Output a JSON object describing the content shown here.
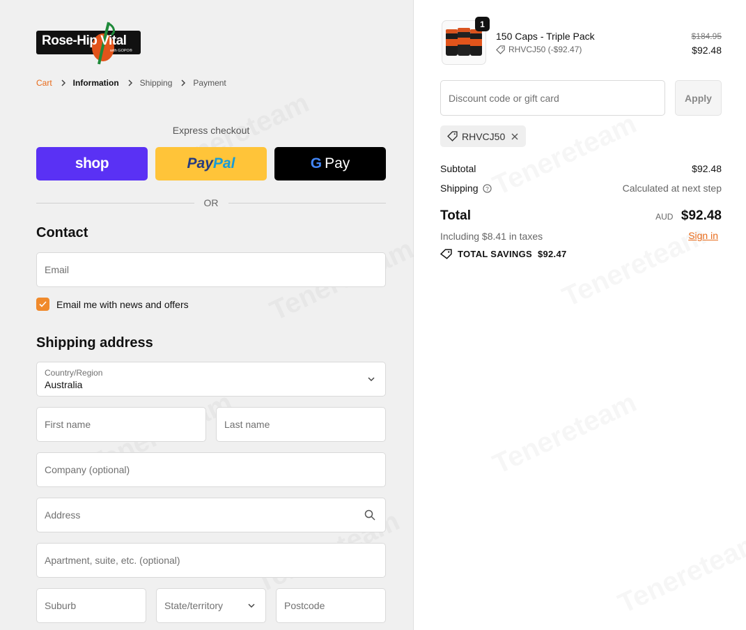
{
  "brand": {
    "logo_text": "Rose-Hip Vital",
    "logo_sub": "with GOPO®"
  },
  "breadcrumb": [
    {
      "label": "Cart",
      "state": "link"
    },
    {
      "label": "Information",
      "state": "active"
    },
    {
      "label": "Shipping",
      "state": "inactive"
    },
    {
      "label": "Payment",
      "state": "inactive"
    }
  ],
  "express": {
    "label": "Express checkout",
    "shop_label": "shop",
    "paypal_part1": "Pay",
    "paypal_part2": "Pal",
    "gpay_g": "G",
    "gpay_label": "Pay",
    "or_label": "OR"
  },
  "contact": {
    "title": "Contact",
    "signin_label": "Sign in",
    "email_placeholder": "Email",
    "newsletter_label": "Email me with news and offers",
    "newsletter_checked": true
  },
  "shipping": {
    "title": "Shipping address",
    "country_label": "Country/Region",
    "country_value": "Australia",
    "first_name": "First name",
    "last_name": "Last name",
    "company": "Company (optional)",
    "address": "Address",
    "apartment": "Apartment, suite, etc. (optional)",
    "suburb": "Suburb",
    "state": "State/territory",
    "postcode": "Postcode"
  },
  "order": {
    "item": {
      "quantity": "1",
      "name": "150 Caps - Triple Pack",
      "discount_code_line": "RHVCJ50 (-$92.47)",
      "original_price": "$184.95",
      "price": "$92.48"
    },
    "discount_placeholder": "Discount code or gift card",
    "apply_label": "Apply",
    "applied_code": "RHVCJ50",
    "subtotal_label": "Subtotal",
    "subtotal_value": "$92.48",
    "shipping_label": "Shipping",
    "shipping_value": "Calculated at next step",
    "total_label": "Total",
    "currency": "AUD",
    "total_value": "$92.48",
    "tax_line": "Including $8.41 in taxes",
    "savings_label": "TOTAL SAVINGS",
    "savings_value": "$92.47"
  },
  "colors": {
    "accent": "#e86a19",
    "checkbox": "#f08a2c",
    "shop_pay": "#5a31f4",
    "paypal": "#ffc439",
    "gpay": "#000000"
  }
}
